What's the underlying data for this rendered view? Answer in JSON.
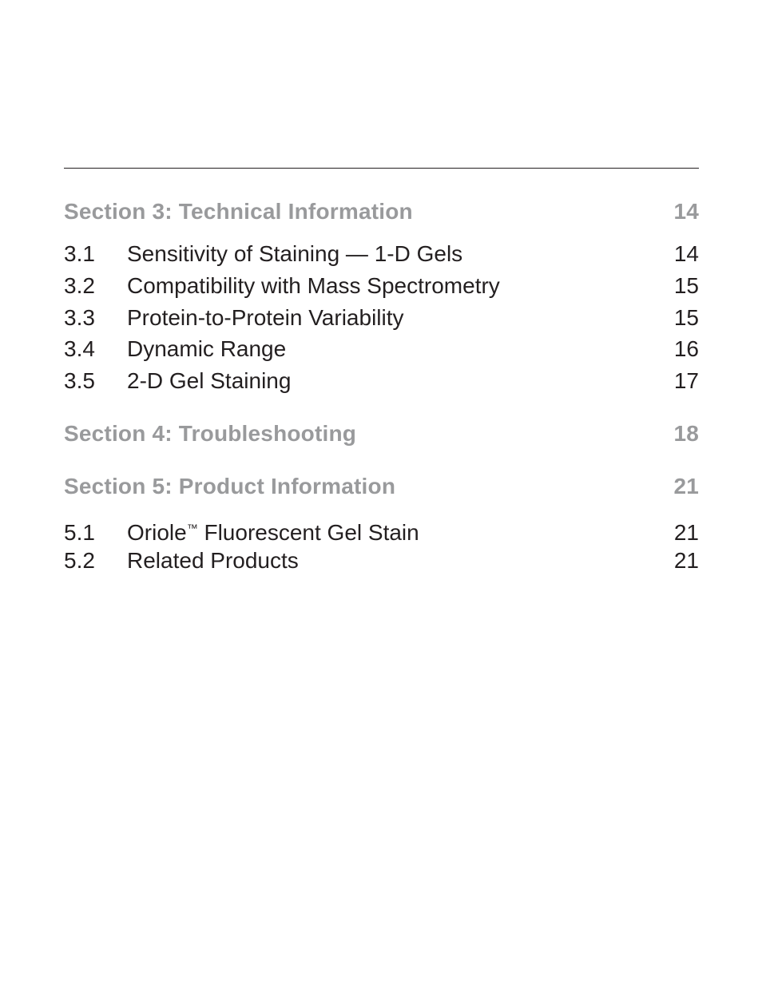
{
  "toc": {
    "sections": [
      {
        "title": "Section 3: Technical Information",
        "page": "14",
        "entries": [
          {
            "num": "3.1",
            "title": "Sensitivity of Staining — 1-D Gels",
            "page": "14"
          },
          {
            "num": "3.2",
            "title": "Compatibility with Mass Spectrometry",
            "page": "15"
          },
          {
            "num": "3.3",
            "title": "Protein-to-Protein Variability",
            "page": "15"
          },
          {
            "num": "3.4",
            "title": "Dynamic Range",
            "page": "16"
          },
          {
            "num": "3.5",
            "title": "2-D Gel Staining",
            "page": "17"
          }
        ]
      },
      {
        "title": "Section 4: Troubleshooting",
        "page": "18",
        "entries": []
      },
      {
        "title": "Section 5: Product Information",
        "page": "21",
        "entries": [
          {
            "num": "5.1",
            "title": "Oriole",
            "title_mark": "™",
            "title_rest": " Fluorescent Gel Stain",
            "page": "21"
          },
          {
            "num": "5.2",
            "title": "Related Products",
            "page": "21"
          }
        ]
      }
    ]
  },
  "colors": {
    "section_heading": "#999a9c",
    "entry_text": "#231f20",
    "rule": "#231f20"
  }
}
